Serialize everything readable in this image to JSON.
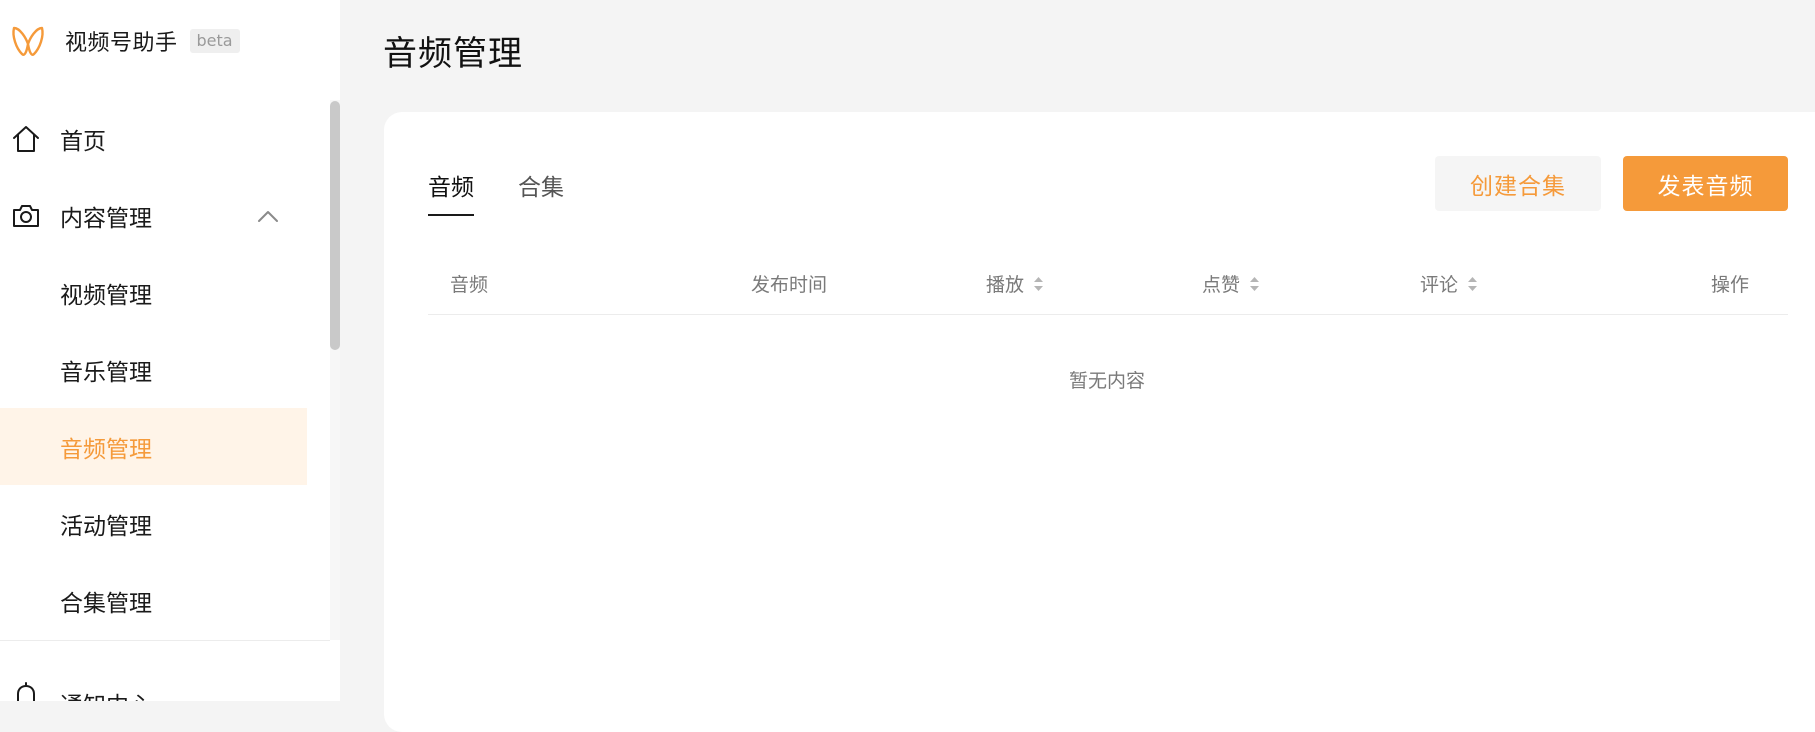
{
  "brand": {
    "name": "视频号助手",
    "badge": "beta",
    "accent_color": "#f59a3a"
  },
  "sidebar": {
    "items": [
      {
        "label": "首页",
        "icon": "home-icon"
      },
      {
        "label": "内容管理",
        "icon": "camera-icon",
        "expanded": true
      },
      {
        "label": "视频管理"
      },
      {
        "label": "音乐管理"
      },
      {
        "label": "音频管理",
        "active": true
      },
      {
        "label": "活动管理"
      },
      {
        "label": "合集管理"
      }
    ],
    "bottom_item": {
      "label": "通知中心",
      "icon": "bell-icon"
    }
  },
  "main": {
    "title": "音频管理",
    "tabs": [
      {
        "label": "音频",
        "active": true
      },
      {
        "label": "合集"
      }
    ],
    "buttons": {
      "create_collection": "创建合集",
      "publish_audio": "发表音频"
    },
    "table": {
      "columns": [
        "音频",
        "发布时间",
        "播放",
        "点赞",
        "评论",
        "操作"
      ],
      "sortable_columns": [
        "播放",
        "点赞",
        "评论"
      ],
      "rows": []
    },
    "empty_text": "暂无内容"
  }
}
